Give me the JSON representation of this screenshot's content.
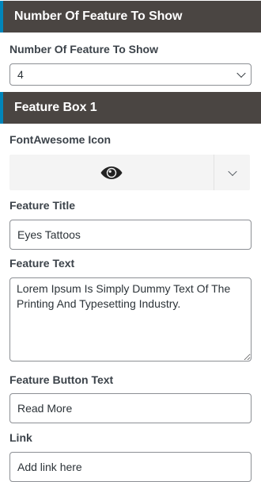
{
  "sections": {
    "feature_count": {
      "title": "Number Of Feature To Show"
    },
    "feature_box_1": {
      "title": "Feature Box 1"
    }
  },
  "feature_count": {
    "label": "Number Of Feature To Show",
    "selected_value": "4"
  },
  "feature_box_1": {
    "icon_label": "FontAwesome Icon",
    "icon_selected": "eye-icon",
    "title_label": "Feature Title",
    "title_value": "Eyes Tattoos",
    "text_label": "Feature Text",
    "text_value": "Lorem Ipsum Is Simply Dummy Text Of The Printing And Typesetting Industry.",
    "button_text_label": "Feature Button Text",
    "button_text_value": "Read More",
    "link_label": "Link",
    "link_placeholder": "Add link here"
  },
  "colors": {
    "header_bg": "#4a4542",
    "header_accent": "#0085ba"
  }
}
